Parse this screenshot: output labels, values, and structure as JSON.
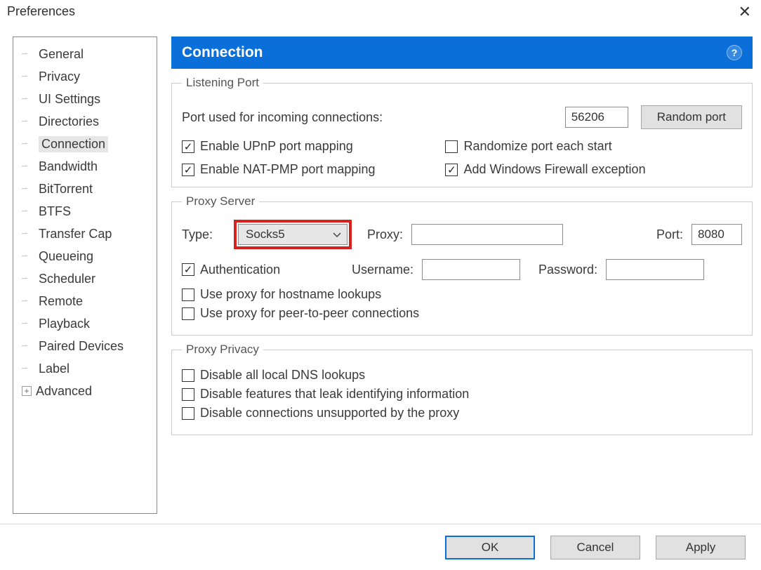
{
  "window": {
    "title": "Preferences"
  },
  "tree": {
    "items": [
      {
        "label": "General"
      },
      {
        "label": "Privacy"
      },
      {
        "label": "UI Settings"
      },
      {
        "label": "Directories"
      },
      {
        "label": "Connection",
        "selected": true
      },
      {
        "label": "Bandwidth"
      },
      {
        "label": "BitTorrent"
      },
      {
        "label": "BTFS"
      },
      {
        "label": "Transfer Cap"
      },
      {
        "label": "Queueing"
      },
      {
        "label": "Scheduler"
      },
      {
        "label": "Remote"
      },
      {
        "label": "Playback"
      },
      {
        "label": "Paired Devices"
      },
      {
        "label": "Label"
      }
    ],
    "advanced_label": "Advanced"
  },
  "panel": {
    "title": "Connection",
    "listening": {
      "legend": "Listening Port",
      "port_label": "Port used for incoming connections:",
      "port_value": "56206",
      "random_btn": "Random port",
      "upnp_label": "Enable UPnP port mapping",
      "upnp_checked": true,
      "natpmp_label": "Enable NAT-PMP port mapping",
      "natpmp_checked": true,
      "randomize_label": "Randomize port each start",
      "randomize_checked": false,
      "firewall_label": "Add Windows Firewall exception",
      "firewall_checked": true
    },
    "proxy": {
      "legend": "Proxy Server",
      "type_label": "Type:",
      "type_value": "Socks5",
      "proxy_label": "Proxy:",
      "proxy_value": "",
      "port_label": "Port:",
      "port_value": "8080",
      "auth_label": "Authentication",
      "auth_checked": true,
      "username_label": "Username:",
      "username_value": "",
      "password_label": "Password:",
      "password_value": "",
      "hostname_lookup_label": "Use proxy for hostname lookups",
      "hostname_lookup_checked": false,
      "p2p_label": "Use proxy for peer-to-peer connections",
      "p2p_checked": false
    },
    "privacy": {
      "legend": "Proxy Privacy",
      "dns_label": "Disable all local DNS lookups",
      "dns_checked": false,
      "leak_label": "Disable features that leak identifying information",
      "leak_checked": false,
      "unsupported_label": "Disable connections unsupported by the proxy",
      "unsupported_checked": false
    }
  },
  "buttons": {
    "ok": "OK",
    "cancel": "Cancel",
    "apply": "Apply"
  }
}
